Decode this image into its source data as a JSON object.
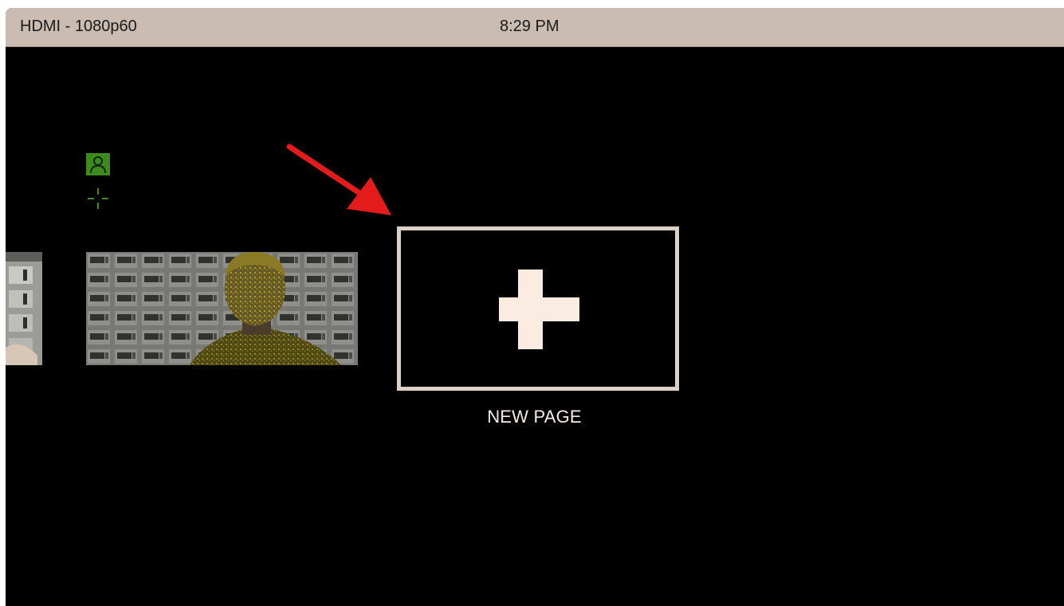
{
  "status_bar": {
    "input_label": "HDMI - 1080p60",
    "time": "8:29 PM"
  },
  "overlay_icons": [
    "person-icon",
    "crosshair-icon"
  ],
  "new_page": {
    "label": "NEW PAGE",
    "icon": "plus-icon"
  },
  "colors": {
    "status_bar_bg": "#cbbcb1",
    "screen_bg": "#000000",
    "new_page_border": "#ddd0c6",
    "plus": "#fbece2",
    "overlay_green": "#3f8a1e",
    "annotation_arrow": "#e31b1b"
  }
}
